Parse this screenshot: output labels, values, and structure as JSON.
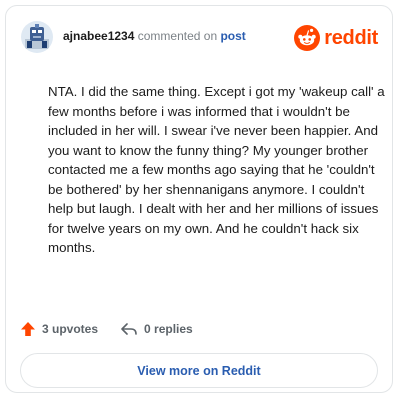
{
  "comment": {
    "username": "ajnabee1234",
    "action_text": "commented on",
    "post_link": "post",
    "body": "NTA. I did the same thing. Except i got my 'wakeup call' a few months before i was informed that i wouldn't be included in her will. I swear i've never been happier. And you want to know the funny thing? My younger brother contacted me a few months ago saying that he 'couldn't be bothered' by her shennanigans anymore. I couldn't help but laugh. I dealt with her and her millions of issues for twelve years on my own. And he couldn't hack six months."
  },
  "brand": {
    "wordmark": "reddit",
    "icon": "reddit-snoo-icon",
    "color": "#ff4500"
  },
  "actions": {
    "upvotes": "3 upvotes",
    "upvote_icon": "upvote-arrow-icon",
    "upvote_color": "#ff4500",
    "replies": "0 replies",
    "reply_icon": "reply-arrow-icon"
  },
  "footer": {
    "view_more_label": "View more on Reddit",
    "link_color": "#2a5db0"
  }
}
